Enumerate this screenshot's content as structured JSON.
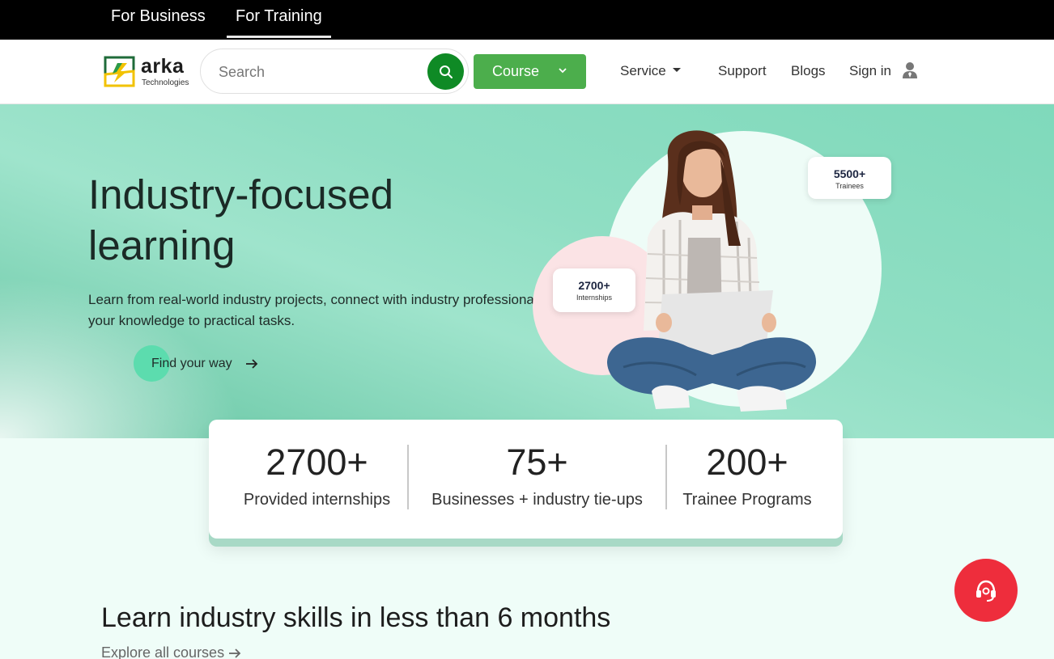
{
  "topbar": {
    "tabs": [
      {
        "label": "For Business"
      },
      {
        "label": "For Training",
        "active": true
      }
    ]
  },
  "navbar": {
    "logo": {
      "word": "arka",
      "sub": "Technologies"
    },
    "search": {
      "placeholder": "Search"
    },
    "course_button": "Course",
    "links": {
      "service": "Service",
      "support": "Support",
      "blogs": "Blogs",
      "signin": "Sign in"
    }
  },
  "hero": {
    "title": "Industry-focused learning",
    "description": "Learn from real-world industry projects, connect with industry professionals, apply your knowledge to practical tasks.",
    "cta": "Find your way",
    "badges": [
      {
        "value": "5500+",
        "caption": "Trainees"
      },
      {
        "value": "2700+",
        "caption": "Internships"
      }
    ]
  },
  "stats": [
    {
      "value": "2700+",
      "label": "Provided internships"
    },
    {
      "value": "75+",
      "label": "Businesses + industry tie-ups"
    },
    {
      "value": "200+",
      "label": "Trainee Programs"
    }
  ],
  "section": {
    "title": "Learn industry skills in less than 6 months",
    "link": "Explore all courses"
  },
  "colors": {
    "accent_green": "#4cae4c",
    "search_button": "#0f8a25",
    "help_button": "#ee2d3c",
    "hero_bg": "#8fdec3"
  },
  "icons": [
    "search-icon",
    "chevron-down-icon",
    "user-icon",
    "arrow-right-icon",
    "headset-icon"
  ]
}
